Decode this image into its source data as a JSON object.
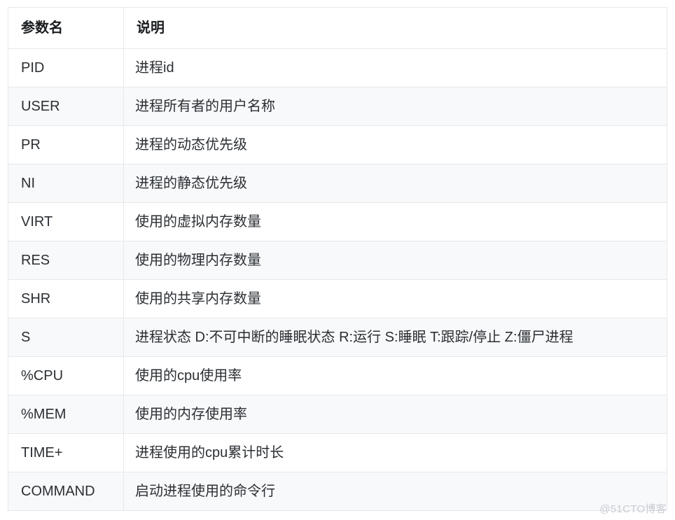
{
  "table": {
    "headers": {
      "name": "参数名",
      "description": "说明"
    },
    "rows": [
      {
        "name": "PID",
        "description": "进程id"
      },
      {
        "name": "USER",
        "description": "进程所有者的用户名称"
      },
      {
        "name": "PR",
        "description": "进程的动态优先级"
      },
      {
        "name": "NI",
        "description": "进程的静态优先级"
      },
      {
        "name": "VIRT",
        "description": "使用的虚拟内存数量"
      },
      {
        "name": "RES",
        "description": "使用的物理内存数量"
      },
      {
        "name": "SHR",
        "description": "使用的共享内存数量"
      },
      {
        "name": "S",
        "description": "进程状态 D:不可中断的睡眠状态 R:运行 S:睡眠 T:跟踪/停止 Z:僵尸进程"
      },
      {
        "name": "%CPU",
        "description": "使用的cpu使用率"
      },
      {
        "name": "%MEM",
        "description": "使用的内存使用率"
      },
      {
        "name": "TIME+",
        "description": "进程使用的cpu累计时长"
      },
      {
        "name": "COMMAND",
        "description": "启动进程使用的命令行"
      }
    ]
  },
  "watermark": {
    "text": "@51CTO博客"
  },
  "colors": {
    "page_background": "#ffffff",
    "row_stripe": "#f7f9fb",
    "border": "#e6e8eb",
    "text": "#2b2f33",
    "header_text": "#1a1d20",
    "watermark_text": "#c9ccd1"
  }
}
